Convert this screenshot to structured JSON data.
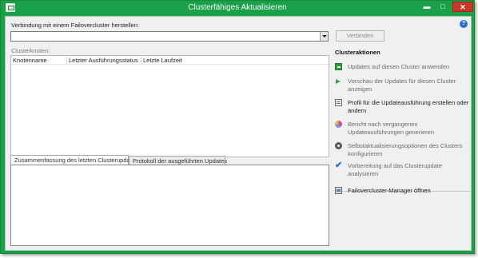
{
  "window": {
    "title": "Clusterfähiges Aktualisieren",
    "controls": {
      "minimize": "▬",
      "maximize": "□",
      "close": "✕"
    }
  },
  "help": {
    "label": "?"
  },
  "connect": {
    "label": "Verbindung mit einem Failovercluster herstellen:",
    "value": "",
    "button_label": "Verbinden"
  },
  "nodes": {
    "label": "Clusterknoten:",
    "columns": [
      "Knotenname",
      "Letzter Ausführungsstatus",
      "Letzte Laufzeit"
    ]
  },
  "tabs": [
    {
      "label": "Zusammenfassung des letzten Clusterupdates",
      "selected": true
    },
    {
      "label": "Protokoll der ausgeführten Updates",
      "selected": false
    }
  ],
  "actions": {
    "heading": "Clusteraktionen",
    "items": [
      {
        "icon": "apply-updates-icon",
        "label": "Updates auf diesen Cluster anwenden",
        "enabled": false
      },
      {
        "icon": "preview-arrow-icon",
        "label": "Vorschau der Updates für diesen Cluster anzeigen",
        "enabled": false
      },
      {
        "icon": "profile-document-icon",
        "label": "Profil für die Updateausführung erstellen oder ändern",
        "enabled": true
      },
      {
        "icon": "report-chart-icon",
        "label": "Bericht nach vergangenen Updateausführungen generieren",
        "enabled": false
      },
      {
        "icon": "gear-icon",
        "label": "Selbstaktualisierungsoptionen des Clusters konfigurieren",
        "enabled": false
      },
      {
        "icon": "checkmark-icon",
        "label": "Vorbereitung auf das Clusterupdate analysieren",
        "enabled": false
      },
      {
        "icon": "cluster-manager-icon",
        "label": "Failovercluster-Manager öffnen",
        "enabled": true
      }
    ]
  },
  "colors": {
    "window_frame": "#1ba04a",
    "close_button": "#c7372a",
    "client_background": "#f0f0f0"
  }
}
